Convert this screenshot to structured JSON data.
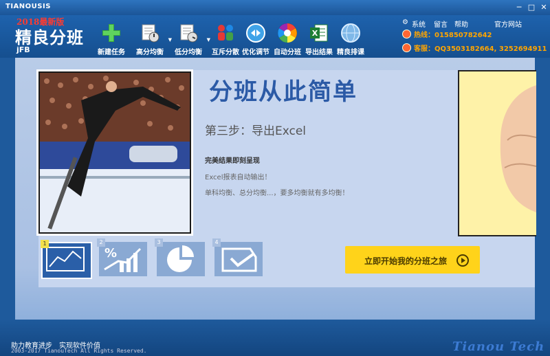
{
  "window": {
    "title": "TIANOUSIS",
    "min": "─",
    "max": "□",
    "close": "✕"
  },
  "logo": {
    "version": "2018最新版",
    "name": "精良分班",
    "sub": "jFB"
  },
  "toolbar": [
    {
      "label": "新建任务",
      "icon": "plus-icon",
      "dropdown": false
    },
    {
      "label": "高分均衡",
      "icon": "balance-up-icon",
      "dropdown": true
    },
    {
      "label": "低分均衡",
      "icon": "balance-down-icon",
      "dropdown": true
    },
    {
      "label": "互斥分散",
      "icon": "people-icon",
      "dropdown": false
    },
    {
      "label": "优化调节",
      "icon": "optimize-icon",
      "dropdown": false
    },
    {
      "label": "自动分班",
      "icon": "color-wheel-icon",
      "dropdown": false
    },
    {
      "label": "导出结果",
      "icon": "excel-icon",
      "dropdown": false
    },
    {
      "label": "精良排课",
      "icon": "globe-icon",
      "dropdown": false
    }
  ],
  "toplinks": {
    "system": "系统",
    "message": "留言",
    "help": "帮助",
    "site": "官方网站"
  },
  "hotline": "热线：015850782642",
  "service": "客服：QQ3503182664, 3252694911",
  "main": {
    "headline": "分班从此简单",
    "step": "第三步：导出Excel",
    "line1": "完美结果即刻呈现",
    "line2": "Excel报表自动输出！",
    "line3": "单科均衡、总分均衡...，要多均衡就有多均衡！"
  },
  "thumbs": [
    {
      "num": "1",
      "icon": "line-chart-icon"
    },
    {
      "num": "2",
      "icon": "percent-chart-icon"
    },
    {
      "num": "3",
      "icon": "pie-chart-icon"
    },
    {
      "num": "4",
      "icon": "export-check-icon"
    }
  ],
  "start_button": "立即开始我的分班之旅",
  "footer": {
    "slogan": "助力教育进步　实现软件价值",
    "copyright": "2003-2017 TianouTech All Rights Reserved.",
    "brand": "Tianou Tech"
  }
}
